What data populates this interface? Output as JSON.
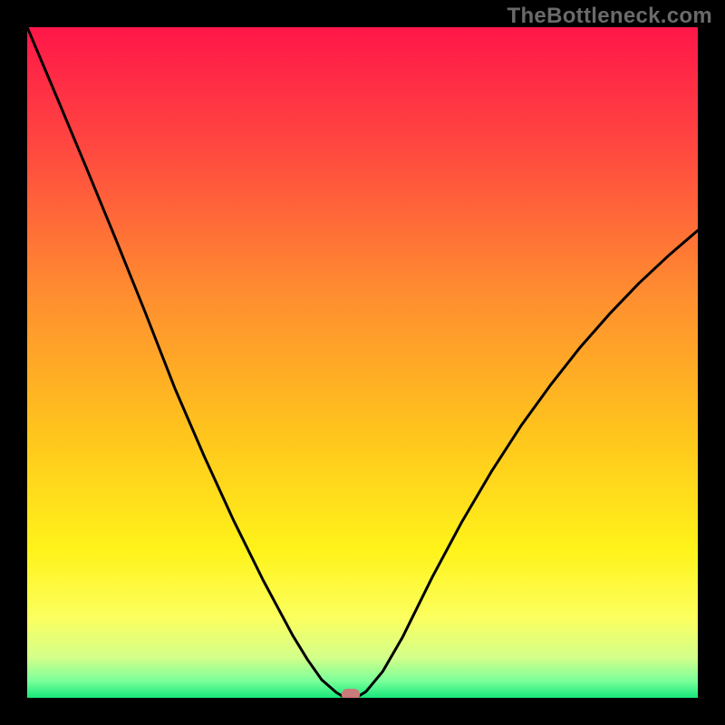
{
  "watermark": "TheBottleneck.com",
  "colors": {
    "frame": "#000000",
    "watermark": "#6a6a6a",
    "curve": "#000000",
    "marker": "#c97a7b"
  },
  "gradient_stops": [
    {
      "offset": 0.0,
      "color": "#ff1649"
    },
    {
      "offset": 0.18,
      "color": "#ff4840"
    },
    {
      "offset": 0.4,
      "color": "#ff8e30"
    },
    {
      "offset": 0.6,
      "color": "#ffc31d"
    },
    {
      "offset": 0.78,
      "color": "#fff31a"
    },
    {
      "offset": 0.88,
      "color": "#fcff5e"
    },
    {
      "offset": 0.94,
      "color": "#d3ff8a"
    },
    {
      "offset": 0.975,
      "color": "#7aff9a"
    },
    {
      "offset": 1.0,
      "color": "#17e87a"
    }
  ],
  "chart_data": {
    "type": "line",
    "title": "",
    "xlabel": "",
    "ylabel": "",
    "xlim": [
      0,
      1
    ],
    "ylim": [
      0,
      1
    ],
    "series": [
      {
        "name": "bottleneck-curve",
        "x": [
          0.0,
          0.044,
          0.088,
          0.132,
          0.176,
          0.22,
          0.264,
          0.308,
          0.352,
          0.396,
          0.418,
          0.439,
          0.461,
          0.474,
          0.49,
          0.505,
          0.53,
          0.56,
          0.604,
          0.648,
          0.692,
          0.736,
          0.78,
          0.824,
          0.868,
          0.912,
          0.956,
          1.0
        ],
        "y": [
          1.0,
          0.896,
          0.791,
          0.684,
          0.575,
          0.462,
          0.36,
          0.264,
          0.175,
          0.093,
          0.057,
          0.027,
          0.008,
          0.0,
          0.0,
          0.009,
          0.039,
          0.091,
          0.18,
          0.262,
          0.337,
          0.405,
          0.466,
          0.522,
          0.572,
          0.618,
          0.659,
          0.697
        ]
      }
    ],
    "marker": {
      "x": 0.482,
      "y": 0.005
    },
    "grid": false,
    "legend": false
  }
}
